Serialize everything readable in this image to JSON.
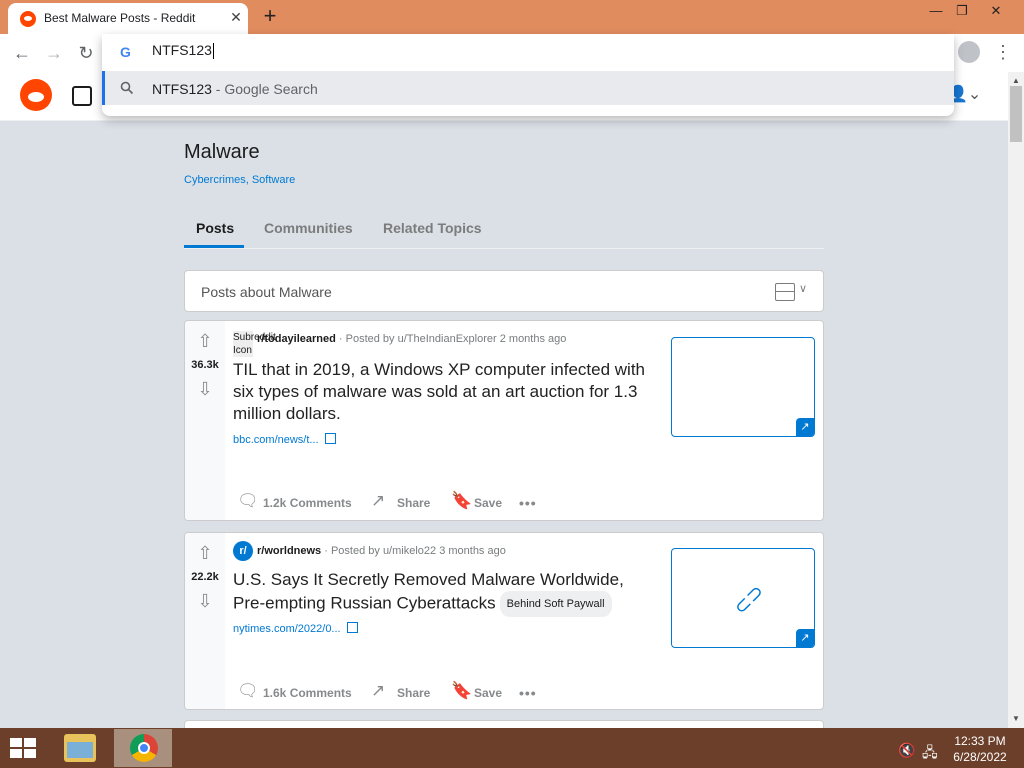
{
  "browser": {
    "tab_title": "Best Malware Posts - Reddit",
    "tab_close": "✕",
    "new_tab": "+",
    "window_controls": [
      "—",
      "❐",
      "✕"
    ],
    "address_input": "NTFS123",
    "suggestion": {
      "query": "NTFS123",
      "sub": " - Google Search"
    }
  },
  "page": {
    "title": "Malware",
    "topics": "Cybercrimes, Software",
    "tabs": [
      "Posts",
      "Communities",
      "Related Topics"
    ],
    "posts_about": "Posts about Malware"
  },
  "posts": [
    {
      "votes": "36.3k",
      "subreddit": "r/todayilearned",
      "meta": " · Posted by u/TheIndianExplorer 2 months ago",
      "broken_icon_alt": "Subreddit Icon",
      "title": "TIL that in 2019, a Windows XP computer infected with six types of malware was sold at an art auction for 1.3 million dollars.",
      "link": "bbc.com/news/t...",
      "comments": "1.2k Comments",
      "share": "Share",
      "save": "Save",
      "more": "•••"
    },
    {
      "votes": "22.2k",
      "subreddit": "r/worldnews",
      "sub_icon": "r/",
      "meta": " · Posted by u/mikelo22 3 months ago",
      "title": "U.S. Says It Secretly Removed Malware Worldwide, Pre-empting Russian Cyberattacks",
      "flair": "Behind Soft Paywall",
      "link": "nytimes.com/2022/0...",
      "comments": "1.6k Comments",
      "share": "Share",
      "save": "Save",
      "more": "•••"
    }
  ],
  "taskbar": {
    "time": "12:33 PM",
    "date": "6/28/2022"
  }
}
